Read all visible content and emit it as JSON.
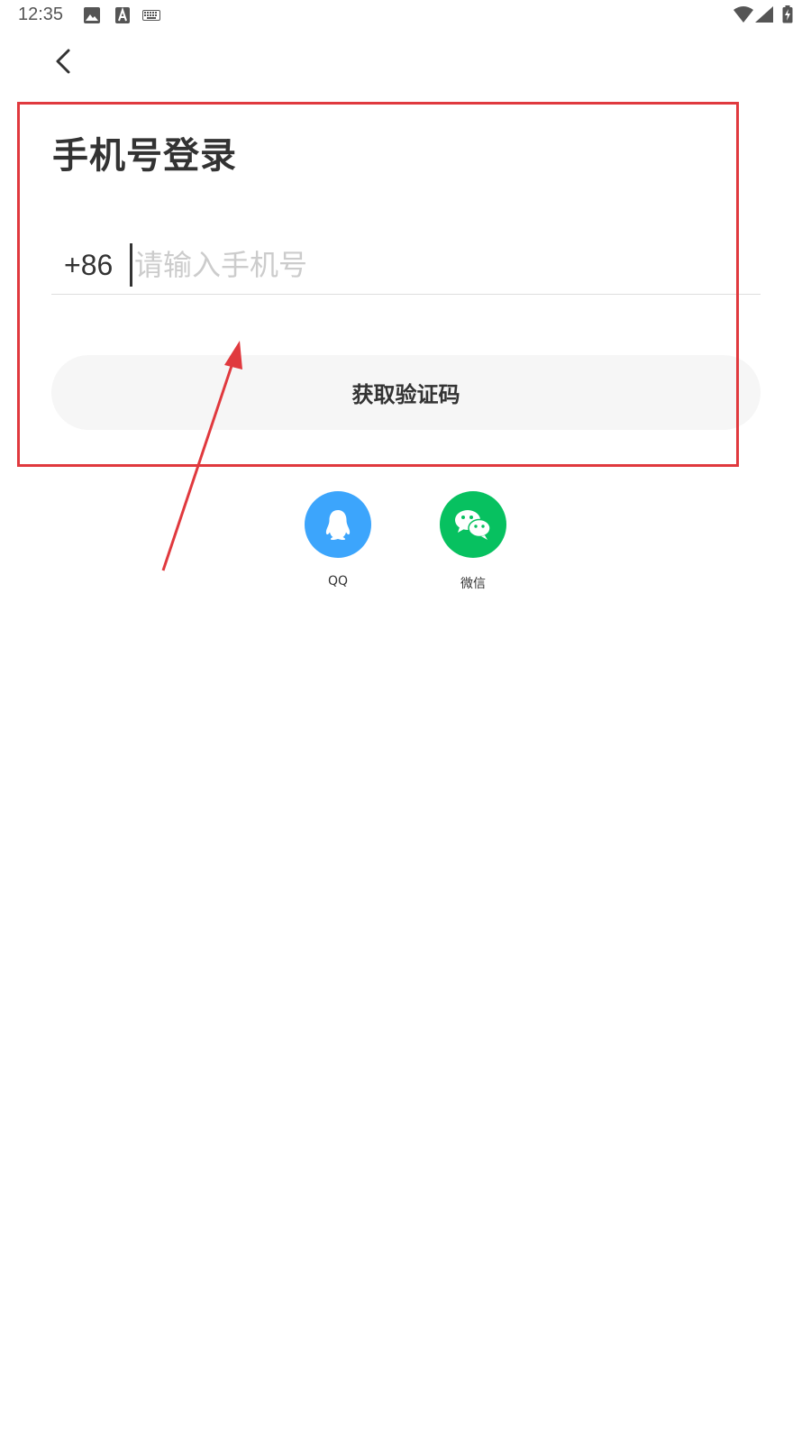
{
  "status_bar": {
    "time": "12:35"
  },
  "page": {
    "title": "手机号登录"
  },
  "phone": {
    "country_code": "+86",
    "placeholder": "请输入手机号",
    "value": ""
  },
  "actions": {
    "get_code_label": "获取验证码"
  },
  "social": {
    "items": [
      {
        "label": "QQ",
        "icon": "qq-penguin-icon",
        "color": "#3ca5fc"
      },
      {
        "label": "微信",
        "icon": "wechat-icon",
        "color": "#07c160"
      }
    ]
  },
  "annotation": {
    "color": "#e0393e"
  }
}
